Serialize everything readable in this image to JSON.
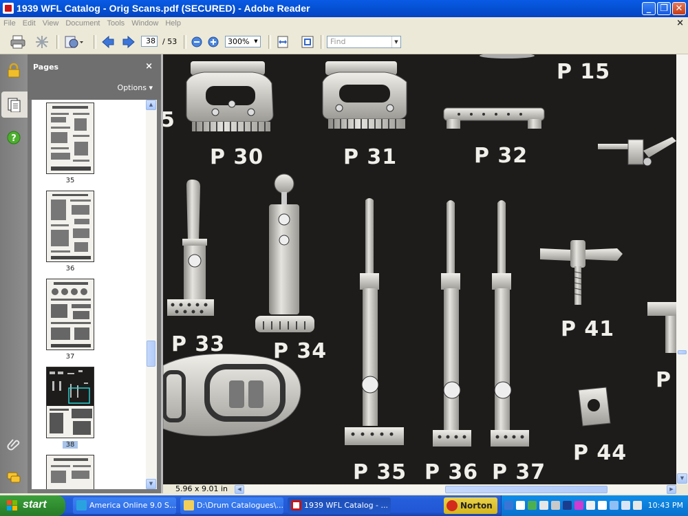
{
  "window": {
    "title": "1939 WFL Catalog - Orig Scans.pdf (SECURED) - Adobe Reader",
    "minimize": "_",
    "maximize": "❐",
    "close": "✕"
  },
  "menu": {
    "items": [
      "File",
      "Edit",
      "View",
      "Document",
      "Tools",
      "Window",
      "Help"
    ],
    "close_doc": "×"
  },
  "toolbar": {
    "current_page": "38",
    "total_pages": "/ 53",
    "zoom": "300%",
    "find_placeholder": "Find"
  },
  "pages_panel": {
    "title": "Pages",
    "close": "×",
    "options": "Options ▾",
    "thumbs": [
      {
        "label": "35"
      },
      {
        "label": "36"
      },
      {
        "label": "37"
      },
      {
        "label": "38"
      }
    ]
  },
  "document": {
    "dimensions": "5.96 x 9.01 in",
    "part_labels": {
      "p15": "P 15",
      "p5": "5",
      "p30": "P 30",
      "p31": "P 31",
      "p32": "P 32",
      "p33": "P 33",
      "p34": "P 34",
      "p41": "P 41",
      "p44": "P 44",
      "p35": "P 35",
      "p36": "P 36",
      "p37": "P 37",
      "pedge": "P"
    }
  },
  "taskbar": {
    "start": "start",
    "tasks": [
      {
        "label": "America Online 9.0 S..."
      },
      {
        "label": "D:\\Drum Catalogues\\..."
      },
      {
        "label": "1939 WFL Catalog - ..."
      }
    ],
    "norton": "Norton",
    "clock": "10:43 PM"
  },
  "colors": {
    "titlebar": "#0553d5",
    "document_bg": "#1e1c1b",
    "taskbar": "#245edb",
    "start_green": "#2e8a2e",
    "selected_thumb": "#a8c4e8"
  }
}
